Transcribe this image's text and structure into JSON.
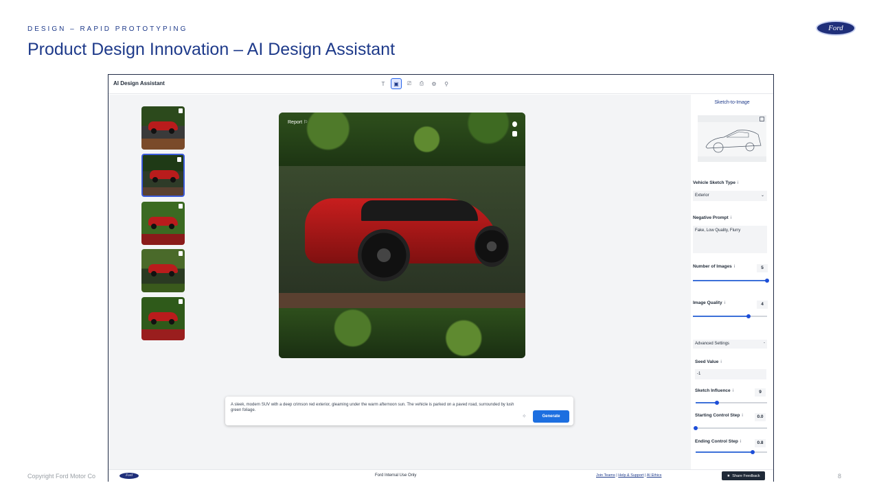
{
  "slide": {
    "kicker": "DESIGN – RAPID PROTOTYPING",
    "title": "Product Design Innovation – AI Design Assistant",
    "logo_text": "Ford",
    "copyright": "Copyright Ford Motor Co",
    "page_number": "8"
  },
  "app": {
    "title": "AI Design Assistant",
    "tools": [
      "T",
      "▣",
      "⎚",
      "⎙",
      "⚙",
      "⚲"
    ],
    "main_image": {
      "report_label": "Report"
    },
    "prompt": {
      "text": "A sleek, modern SUV with a deep crimson red exterior, gleaming under the warm afternoon sun. The vehicle is parked on a paved road, surrounded by lush green foliage.",
      "generate_label": "Generate"
    },
    "panel": {
      "title": "Sketch-to-Image",
      "sketch_type_label": "Vehicle Sketch Type",
      "sketch_type_value": "Exterior",
      "negative_prompt_label": "Negative Prompt",
      "negative_prompt_value": "Fake, Low Quality, Flurry",
      "num_images_label": "Number of Images",
      "num_images_value": "5",
      "image_quality_label": "Image Quality",
      "image_quality_value": "4",
      "advanced_label": "Advanced Settings",
      "advanced_toggle": "-",
      "seed_label": "Seed Value",
      "seed_value": "-1",
      "sketch_influence_label": "Sketch Influence",
      "sketch_influence_value": "9",
      "start_step_label": "Starting Control Step",
      "start_step_value": "0.0",
      "end_step_label": "Ending Control Step",
      "end_step_value": "0.8",
      "info_glyph": "i"
    },
    "footer": {
      "logo_text": "Ford",
      "center_text": "Ford Internal Use Only",
      "link_join": "Join Teams",
      "link_help": "Help & Support",
      "link_ethics": "AI Ethics",
      "separator": " | ",
      "feedback_label": "Share Feedback"
    }
  },
  "colors": {
    "accent": "#1d6fe0",
    "title_blue": "#1e3a8a",
    "car_red": "#b91c1c"
  },
  "slider_levels": {
    "num_images": 1.0,
    "image_quality": 0.75,
    "sketch_influence": 0.3,
    "start_step": 0.0,
    "end_step": 0.8
  }
}
